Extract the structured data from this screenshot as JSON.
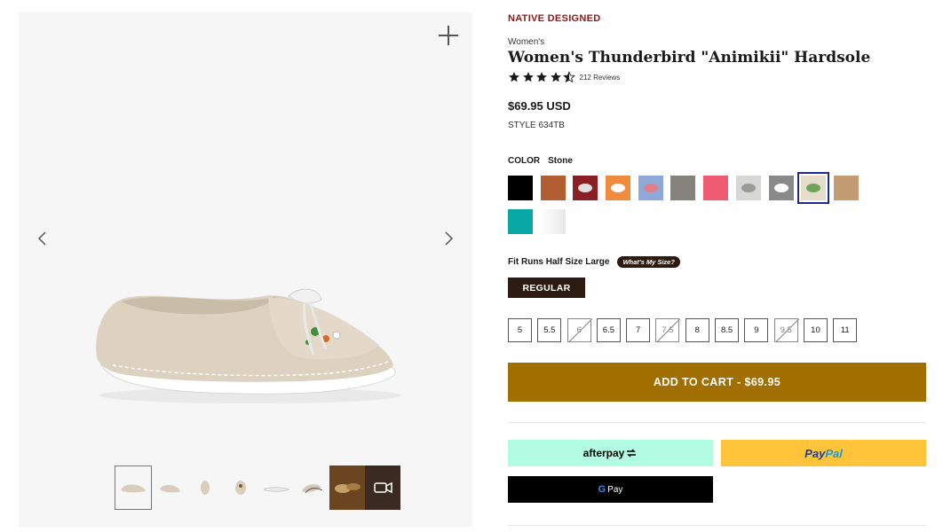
{
  "product": {
    "eyebrow": "NATIVE DESIGNED",
    "category": "Women's",
    "title": "Women's Thunderbird \"Animikii\" Hardsole",
    "rating": 4.5,
    "reviews_label": "212 Reviews",
    "price": "$69.95 USD",
    "style": "STYLE 634TB"
  },
  "color": {
    "label": "COLOR",
    "selected": "Stone",
    "swatches": [
      {
        "name": "black",
        "hex": "#000000"
      },
      {
        "name": "brown",
        "hex": "#b35e32"
      },
      {
        "name": "maroon-beaded",
        "hex": "#8a1f26"
      },
      {
        "name": "orange-beaded",
        "hex": "#f08a3c"
      },
      {
        "name": "blue-beaded",
        "hex": "#8ea8d8"
      },
      {
        "name": "grey",
        "hex": "#85837c"
      },
      {
        "name": "pink",
        "hex": "#ef5b71"
      },
      {
        "name": "white-beaded",
        "hex": "#d7d7d5"
      },
      {
        "name": "grey-beaded",
        "hex": "#8a8a8a"
      },
      {
        "name": "stone",
        "hex": "#e5dccc"
      },
      {
        "name": "tan",
        "hex": "#c49c74"
      },
      {
        "name": "teal",
        "hex": "#0aa7a7"
      },
      {
        "name": "white",
        "hex": "#f2f2f2"
      }
    ]
  },
  "fit": {
    "label": "Fit Runs Half Size Large",
    "help": "What's My Size?",
    "width_option": "REGULAR"
  },
  "sizes": [
    {
      "label": "5",
      "available": true
    },
    {
      "label": "5.5",
      "available": true
    },
    {
      "label": "6",
      "available": false
    },
    {
      "label": "6.5",
      "available": true
    },
    {
      "label": "7",
      "available": true
    },
    {
      "label": "7.5",
      "available": false
    },
    {
      "label": "8",
      "available": true
    },
    {
      "label": "8.5",
      "available": true
    },
    {
      "label": "9",
      "available": true
    },
    {
      "label": "9.5",
      "available": false
    },
    {
      "label": "10",
      "available": true
    },
    {
      "label": "11",
      "available": true
    }
  ],
  "cart": {
    "label": "ADD TO CART - $69.95"
  },
  "payments": {
    "afterpay": "afterpay",
    "paypal_1": "Pay",
    "paypal_2": "Pal",
    "gpay_g": "G",
    "gpay": "Pay"
  },
  "colors": {
    "accent_red": "#8b1a1a",
    "cart_gold": "#a16f00",
    "dark_brown": "#2d1a10",
    "selected_outline": "#1c2b8f"
  }
}
